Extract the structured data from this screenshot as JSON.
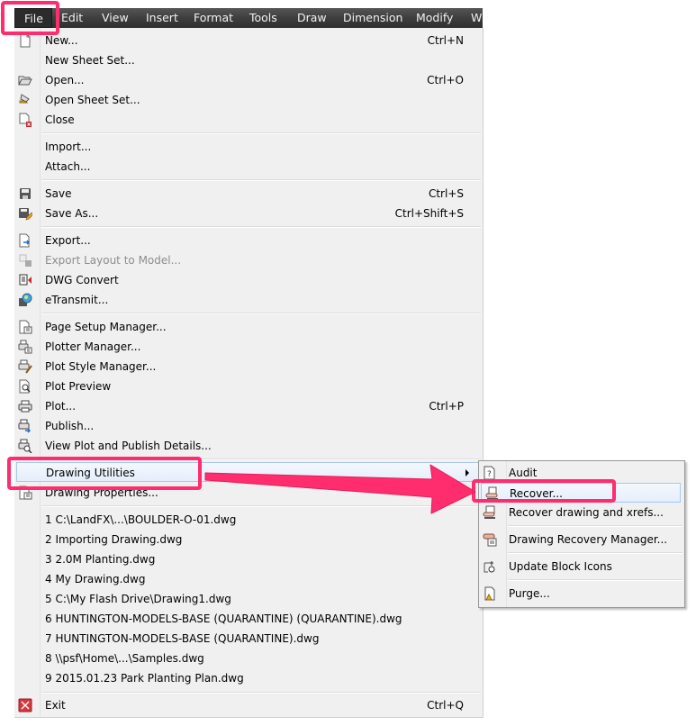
{
  "menubar": {
    "items": [
      "File",
      "Edit",
      "View",
      "Insert",
      "Format",
      "Tools",
      "Draw",
      "Dimension",
      "Modify",
      "W"
    ]
  },
  "file_menu": {
    "groups": [
      [
        {
          "label": "New...",
          "shortcut": "Ctrl+N",
          "icon": "new-document-icon"
        },
        {
          "label": "New Sheet Set...",
          "shortcut": "",
          "icon": ""
        },
        {
          "label": "Open...",
          "shortcut": "Ctrl+O",
          "icon": "open-folder-icon"
        },
        {
          "label": "Open Sheet Set...",
          "shortcut": "",
          "icon": "open-sheet-set-icon"
        },
        {
          "label": "Close",
          "shortcut": "",
          "icon": "close-document-icon"
        }
      ],
      [
        {
          "label": "Import...",
          "shortcut": "",
          "icon": ""
        },
        {
          "label": "Attach...",
          "shortcut": "",
          "icon": ""
        }
      ],
      [
        {
          "label": "Save",
          "shortcut": "Ctrl+S",
          "icon": "save-icon"
        },
        {
          "label": "Save As...",
          "shortcut": "Ctrl+Shift+S",
          "icon": "save-as-icon"
        }
      ],
      [
        {
          "label": "Export...",
          "shortcut": "",
          "icon": "export-icon"
        },
        {
          "label": "Export Layout to Model...",
          "shortcut": "",
          "icon": "export-layout-icon",
          "disabled": true
        },
        {
          "label": "DWG Convert",
          "shortcut": "",
          "icon": "dwg-convert-icon"
        },
        {
          "label": "eTransmit...",
          "shortcut": "",
          "icon": "etransmit-icon"
        }
      ],
      [
        {
          "label": "Page Setup Manager...",
          "shortcut": "",
          "icon": "page-setup-icon"
        },
        {
          "label": "Plotter Manager...",
          "shortcut": "",
          "icon": "plotter-manager-icon"
        },
        {
          "label": "Plot Style Manager...",
          "shortcut": "",
          "icon": "plot-style-icon"
        },
        {
          "label": "Plot Preview",
          "shortcut": "",
          "icon": "plot-preview-icon"
        },
        {
          "label": "Plot...",
          "shortcut": "Ctrl+P",
          "icon": "printer-icon"
        },
        {
          "label": "Publish...",
          "shortcut": "",
          "icon": "publish-icon"
        },
        {
          "label": "View Plot and Publish Details...",
          "shortcut": "",
          "icon": "plot-details-icon"
        }
      ],
      [
        {
          "label": "Drawing Utilities",
          "shortcut": "",
          "icon": "",
          "submenu": true,
          "hover": true
        },
        {
          "label": "Drawing Properties...",
          "shortcut": "",
          "icon": "drawing-properties-icon"
        }
      ],
      [
        {
          "label": "1 C:\\LandFX\\...\\BOULDER-O-01.dwg"
        },
        {
          "label": "2 Importing Drawing.dwg"
        },
        {
          "label": "3 2.0M Planting.dwg"
        },
        {
          "label": "4 My Drawing.dwg"
        },
        {
          "label": "5 C:\\My Flash Drive\\Drawing1.dwg"
        },
        {
          "label": "6 HUNTINGTON-MODELS-BASE (QUARANTINE) (QUARANTINE).dwg"
        },
        {
          "label": "7 HUNTINGTON-MODELS-BASE (QUARANTINE).dwg"
        },
        {
          "label": "8 \\\\psf\\Home\\...\\Samples.dwg"
        },
        {
          "label": "9 2015.01.23 Park Planting Plan.dwg"
        }
      ],
      [
        {
          "label": "Exit",
          "shortcut": "Ctrl+Q",
          "icon": "exit-icon"
        }
      ]
    ]
  },
  "submenu": {
    "parent": "Drawing Utilities",
    "items": [
      {
        "label": "Audit",
        "icon": "audit-icon"
      },
      {
        "label": "Recover...",
        "icon": "recover-icon",
        "hover": true
      },
      {
        "label": "Recover drawing and xrefs...",
        "icon": "recover-xrefs-icon"
      },
      {
        "label": "Drawing Recovery Manager...",
        "icon": "recovery-manager-icon"
      },
      {
        "label": "Update Block Icons",
        "icon": "update-block-icons-icon"
      },
      {
        "label": "Purge...",
        "icon": "purge-icon"
      }
    ]
  },
  "annotation": {
    "color": "#ff2d6e",
    "highlights": [
      "File",
      "Drawing Utilities",
      "Recover..."
    ]
  }
}
